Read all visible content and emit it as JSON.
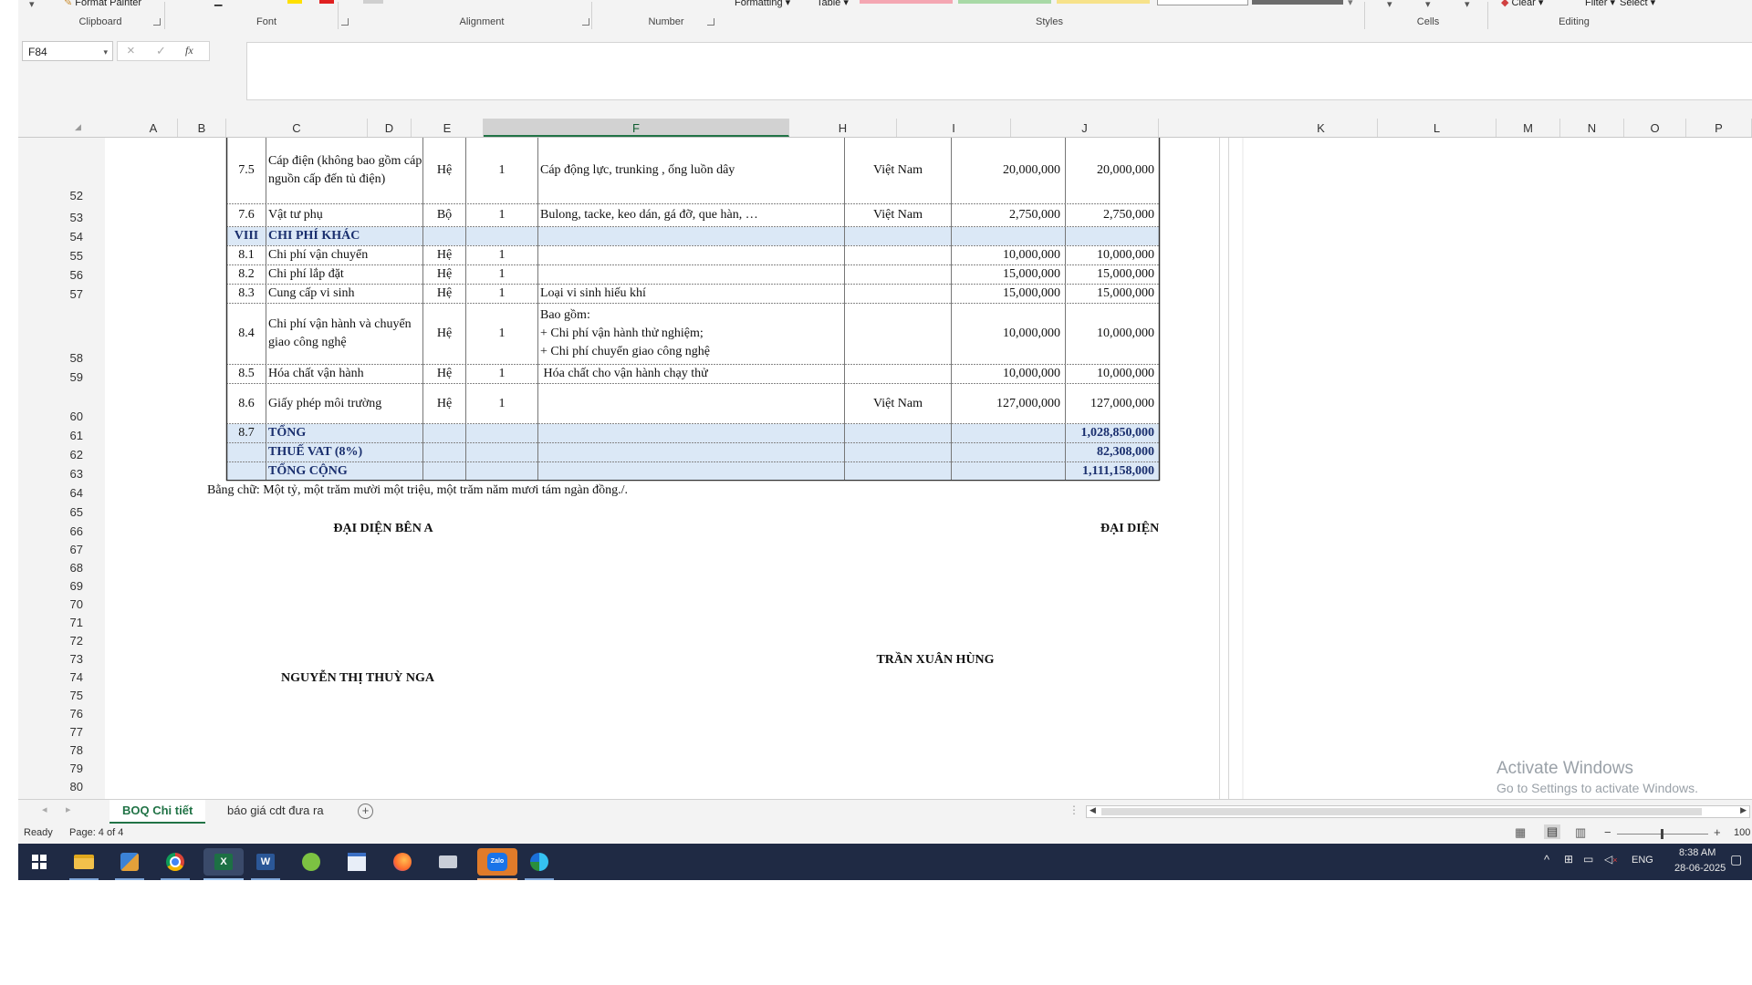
{
  "ribbon": {
    "format_painter": "Format Painter",
    "formatting": "Formatting",
    "table": "Table",
    "clear": "Clear",
    "filter": "Filter",
    "select": "Select",
    "groups": {
      "clipboard": "Clipboard",
      "font": "Font",
      "alignment": "Alignment",
      "number": "Number",
      "styles": "Styles",
      "cells": "Cells",
      "editing": "Editing"
    },
    "colors": {
      "accent": "#217346",
      "swatch_red": "#f4a6b2",
      "swatch_green": "#a8d9a6",
      "swatch_yellow": "#f7e28a"
    }
  },
  "formula_bar": {
    "name_box": "F84",
    "cancel_icon": "×",
    "enter_icon": "✓",
    "fx": "fx",
    "content": ""
  },
  "columns": [
    "A",
    "B",
    "C",
    "D",
    "E",
    "F",
    "H",
    "I",
    "J",
    "K",
    "L",
    "M",
    "N",
    "O",
    "P"
  ],
  "selected_column": "F",
  "rows": [
    "52",
    "53",
    "54",
    "55",
    "56",
    "57",
    "58",
    "59",
    "60",
    "61",
    "62",
    "63",
    "64",
    "65",
    "66",
    "67",
    "68",
    "69",
    "70",
    "71",
    "72",
    "73",
    "74",
    "75",
    "76",
    "77",
    "78",
    "79",
    "80"
  ],
  "table": [
    {
      "row": "52",
      "stt": "7.5",
      "name": "Cáp điện (không bao gồm cáp nguồn cấp đến tủ điện)",
      "unit": "Hệ",
      "qty": "1",
      "desc": "Cáp động lực, trunking , ống luồn dây",
      "origin": "Việt Nam",
      "price": "20,000,000",
      "total": "20,000,000"
    },
    {
      "row": "53",
      "stt": "7.6",
      "name": "Vật tư phụ",
      "unit": "Bộ",
      "qty": "1",
      "desc": "Bulong, tacke, keo dán, gá đỡ, que hàn, …",
      "origin": "Việt Nam",
      "price": "2,750,000",
      "total": "2,750,000"
    },
    {
      "row": "54",
      "stt": "VIII",
      "name": "CHI PHÍ KHÁC",
      "unit": "",
      "qty": "",
      "desc": "",
      "origin": "",
      "price": "",
      "total": ""
    },
    {
      "row": "55",
      "stt": "8.1",
      "name": "Chi phí vận chuyển",
      "unit": "Hệ",
      "qty": "1",
      "desc": "",
      "origin": "",
      "price": "10,000,000",
      "total": "10,000,000"
    },
    {
      "row": "56",
      "stt": "8.2",
      "name": "Chi phí lắp đặt",
      "unit": "Hệ",
      "qty": "1",
      "desc": "",
      "origin": "",
      "price": "15,000,000",
      "total": "15,000,000"
    },
    {
      "row": "57",
      "stt": "8.3",
      "name": "Cung cấp vi sinh",
      "unit": "Hệ",
      "qty": "1",
      "desc": "Loại vi sinh hiếu khí",
      "origin": "",
      "price": "15,000,000",
      "total": "15,000,000"
    },
    {
      "row": "58",
      "stt": "8.4",
      "name": "Chi phí vận hành và chuyển giao công nghệ",
      "unit": "Hệ",
      "qty": "1",
      "desc_lines": [
        "Bao gồm:",
        "+ Chi phí vận hành thử nghiệm;",
        "+ Chi phí chuyển giao công nghệ"
      ],
      "origin": "",
      "price": "10,000,000",
      "total": "10,000,000"
    },
    {
      "row": "59",
      "stt": "8.5",
      "name": "Hóa chất vận hành",
      "unit": "Hệ",
      "qty": "1",
      "desc": " Hóa chất cho vận hành chạy thử",
      "origin": "",
      "price": "10,000,000",
      "total": "10,000,000"
    },
    {
      "row": "60",
      "stt": "8.6",
      "name": "Giấy phép môi trường",
      "unit": "Hệ",
      "qty": "1",
      "desc": "",
      "origin": "Việt Nam",
      "price": "127,000,000",
      "total": "127,000,000"
    },
    {
      "row": "61",
      "stt": "8.7",
      "name": "TỔNG",
      "unit": "",
      "qty": "",
      "desc": "",
      "origin": "",
      "price": "",
      "total": "1,028,850,000"
    },
    {
      "row": "62",
      "stt": "",
      "name": "THUẾ VAT (8%)",
      "unit": "",
      "qty": "",
      "desc": "",
      "origin": "",
      "price": "",
      "total": "82,308,000"
    },
    {
      "row": "63",
      "stt": "",
      "name": "TỔNG CỘNG",
      "unit": "",
      "qty": "",
      "desc": "",
      "origin": "",
      "price": "",
      "total": "1,111,158,000"
    }
  ],
  "in_words": "Bằng chữ: Một tỷ, một trăm mười một triệu, một trăm năm mươi tám ngàn đồng./.",
  "signatures": {
    "party_a": "ĐẠI DIỆN BÊN A",
    "party_b": "ĐẠI DIỆN BÊN",
    "name_b": "TRẦN XUÂN HÙNG",
    "name_a": "NGUYỄN THỊ THUỲ NGA"
  },
  "watermark": {
    "title": "Activate Windows",
    "subtitle": "Go to Settings to activate Windows."
  },
  "sheet_tabs": [
    "BOQ Chi tiết",
    "báo giá cdt đưa ra"
  ],
  "active_tab": "BOQ Chi tiết",
  "add_sheet_icon": "+",
  "status": {
    "ready": "Ready",
    "page": "Page: 4 of 4",
    "zoom": "100"
  },
  "taskbar": {
    "apps": [
      "start-icon",
      "file-explorer-icon",
      "store-icon",
      "chrome-icon",
      "excel-icon",
      "word-icon",
      "greenshot-icon",
      "calendar-icon",
      "firefox-icon",
      "print-icon",
      "zalo-icon",
      "edge-icon"
    ],
    "lang": "ENG",
    "time": "8:38 AM",
    "date": "28-06-2025"
  }
}
